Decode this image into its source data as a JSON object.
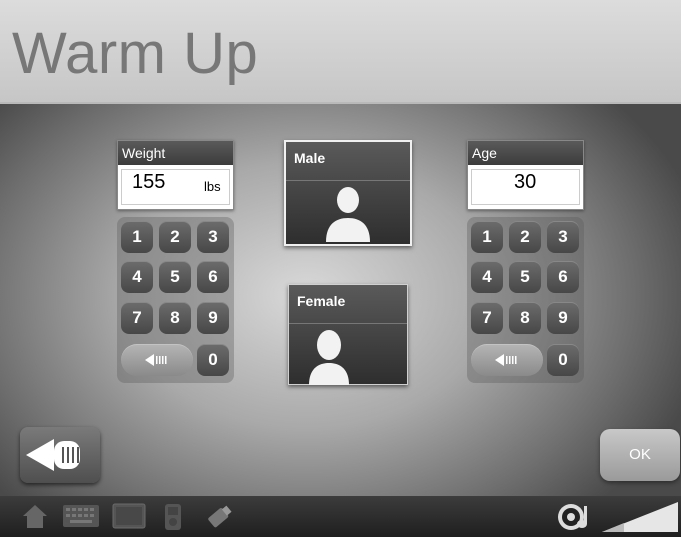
{
  "header": {
    "title": "Warm Up"
  },
  "weight": {
    "label": "Weight",
    "value": "155",
    "unit": "lbs"
  },
  "age": {
    "label": "Age",
    "value": "30"
  },
  "keypad": {
    "keys": [
      "1",
      "2",
      "3",
      "4",
      "5",
      "6",
      "7",
      "8",
      "9",
      "0"
    ]
  },
  "gender": {
    "male_label": "Male",
    "female_label": "Female",
    "selected": "Male"
  },
  "footer": {
    "ok_label": "OK"
  },
  "icons": {
    "back": "back-arrow-icon",
    "home": "home-icon",
    "keyboard": "keyboard-icon",
    "display": "display-icon",
    "media": "media-player-icon",
    "usb": "usb-icon",
    "audio": "audio-icon",
    "volume": "volume-level-icon"
  },
  "colors": {
    "title": "#777777",
    "panel": "#3c3c3c",
    "key": "#555555",
    "ok_button": "#aaaaaa"
  }
}
